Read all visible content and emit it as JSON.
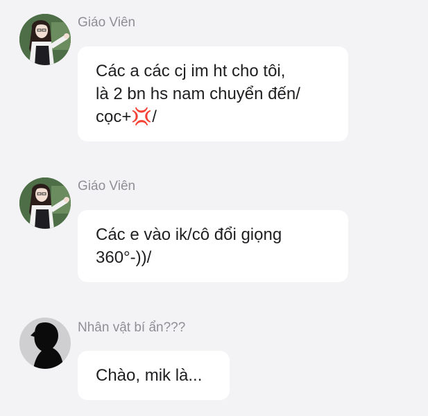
{
  "messages": [
    {
      "sender": "Giáo Viên",
      "avatar": "teacher-avatar",
      "lines": [
        "Các a các cj im ht cho tôi,",
        "là 2 bn hs nam chuyển đến/",
        "cọc+💢/"
      ]
    },
    {
      "sender": "Giáo Viên",
      "avatar": "teacher-avatar",
      "lines": [
        "Các e vào ik/cô đổi giọng",
        "360°-))/"
      ]
    },
    {
      "sender": "Nhân vật bí ẩn???",
      "avatar": "silhouette-avatar",
      "lines": [
        "Chào, mik là..."
      ]
    }
  ],
  "colors": {
    "background": "#f3f3f5",
    "bubble": "#ffffff",
    "sender_text": "#8f8f94",
    "message_text": "#1f1f22"
  }
}
